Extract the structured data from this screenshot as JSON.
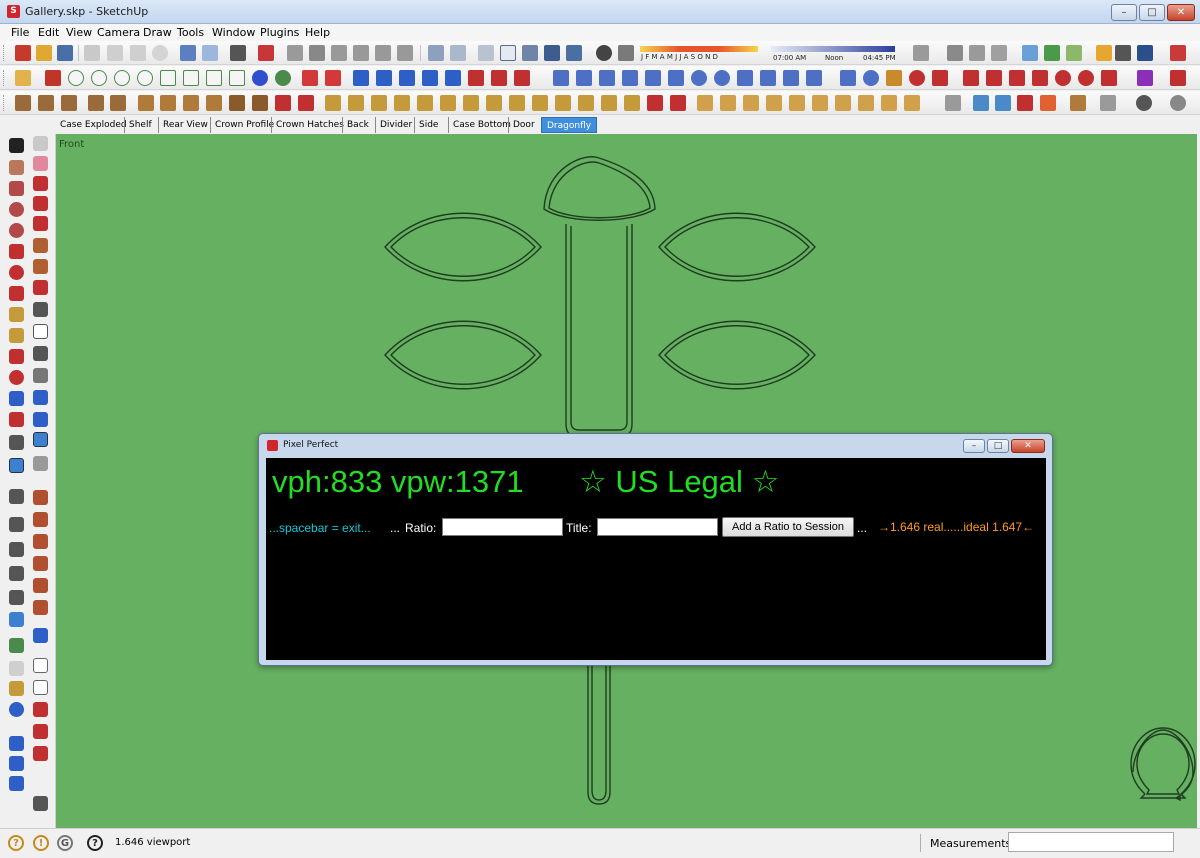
{
  "window": {
    "title": "Gallery.skp - SketchUp",
    "min": "–",
    "max": "□",
    "close": "✕",
    "app_icon": "S"
  },
  "menu": [
    "File",
    "Edit",
    "View",
    "Camera",
    "Draw",
    "Tools",
    "Window",
    "Plugins",
    "Help"
  ],
  "shadow_toolbar": {
    "months": "J F M A M J J A S O N D",
    "time_start": "07:00 AM",
    "time_noon": "Noon",
    "time_end": "04:45 PM"
  },
  "scene_tabs": [
    "Case Exploded",
    "Shelf",
    "Rear View",
    "Crown Profile",
    "Crown Hatches",
    "Back",
    "Divider",
    "Side",
    "Case Bottom",
    "Door",
    "Dragonfly"
  ],
  "active_tab": "Dragonfly",
  "viewport": {
    "view_label": "Front",
    "background": "#66b062"
  },
  "dialog": {
    "title": "Pixel Perfect",
    "stats": "vph:833 vpw:1371",
    "legal": "☆ US Legal ☆",
    "hint": "...spacebar = exit...",
    "dots1": "...",
    "ratio_label": "Ratio:",
    "ratio_value": "",
    "title_label": "Title:",
    "title_value": "",
    "add_button": "Add a Ratio to Session",
    "dots2": "...",
    "ratio_info": "→1.646 real......ideal 1.647←"
  },
  "status": {
    "text": "1.646  viewport",
    "measurements_label": "Measurements",
    "measurements_value": "",
    "icon_1": "?",
    "icon_2": "!",
    "icon_3": "G",
    "icon_4": "?"
  }
}
